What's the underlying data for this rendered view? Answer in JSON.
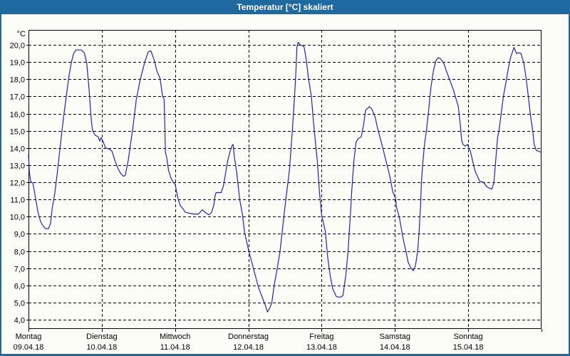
{
  "window": {
    "title": "Temperatur [°C] skaliert"
  },
  "colors": {
    "titlebar_bg": "#1E69A0",
    "titlebar_text": "#FFFFFF",
    "frame_border": "#1E69A0",
    "content_bg": "#FDFDF8",
    "grid": "#000000",
    "axis": "#000000",
    "text": "#000000",
    "series_line": "#2222C0"
  },
  "chart_data": {
    "type": "line",
    "title": "Temperatur [°C] skaliert",
    "y_unit_label": "°C",
    "xlabel": "",
    "ylabel": "Temperatur",
    "grid": "dashed",
    "legend": "none",
    "ylim": [
      3.45,
      20.9
    ],
    "y_ticks": [
      {
        "v": 20,
        "label": "20,0"
      },
      {
        "v": 19,
        "label": "19,0"
      },
      {
        "v": 18,
        "label": "18,0"
      },
      {
        "v": 17,
        "label": "17,0"
      },
      {
        "v": 16,
        "label": "16,0"
      },
      {
        "v": 15,
        "label": "15,0"
      },
      {
        "v": 14,
        "label": "14,0"
      },
      {
        "v": 13,
        "label": "13,0"
      },
      {
        "v": 12,
        "label": "12,0"
      },
      {
        "v": 11,
        "label": "11,0"
      },
      {
        "v": 10,
        "label": "10,0"
      },
      {
        "v": 9,
        "label": "9,0"
      },
      {
        "v": 8,
        "label": "8,0"
      },
      {
        "v": 7,
        "label": "7,0"
      },
      {
        "v": 6,
        "label": "6,0"
      },
      {
        "v": 5,
        "label": "5,0"
      },
      {
        "v": 4,
        "label": "4,0"
      }
    ],
    "x_categories": [
      {
        "day": "Montag",
        "date": "09.04.18"
      },
      {
        "day": "Dienstag",
        "date": "10.04.18"
      },
      {
        "day": "Mittwoch",
        "date": "11.04.18"
      },
      {
        "day": "Donnerstag",
        "date": "12.04.18"
      },
      {
        "day": "Freitag",
        "date": "13.04.18"
      },
      {
        "day": "Samstag",
        "date": "14.04.18"
      },
      {
        "day": "Sonntag",
        "date": "15.04.18"
      }
    ],
    "x_days_total": 7,
    "series": [
      {
        "name": "Temperatur [°C] skaliert",
        "points": [
          [
            0.0,
            13.6
          ],
          [
            0.012,
            12.6
          ],
          [
            0.03,
            12.05
          ],
          [
            0.06,
            11.95
          ],
          [
            0.095,
            11.1
          ],
          [
            0.127,
            10.3
          ],
          [
            0.165,
            9.7
          ],
          [
            0.2,
            9.45
          ],
          [
            0.233,
            9.3
          ],
          [
            0.272,
            9.3
          ],
          [
            0.3,
            9.6
          ],
          [
            0.324,
            10.5
          ],
          [
            0.357,
            11.3
          ],
          [
            0.389,
            12.4
          ],
          [
            0.421,
            13.65
          ],
          [
            0.454,
            14.9
          ],
          [
            0.486,
            16.05
          ],
          [
            0.518,
            17.1
          ],
          [
            0.551,
            18.15
          ],
          [
            0.583,
            18.95
          ],
          [
            0.615,
            19.5
          ],
          [
            0.648,
            19.7
          ],
          [
            0.72,
            19.7
          ],
          [
            0.761,
            19.55
          ],
          [
            0.794,
            18.95
          ],
          [
            0.81,
            18.2
          ],
          [
            0.826,
            17.4
          ],
          [
            0.843,
            16.4
          ],
          [
            0.859,
            15.5
          ],
          [
            0.875,
            15.0
          ],
          [
            0.908,
            14.75
          ],
          [
            0.95,
            14.65
          ],
          [
            0.972,
            14.4
          ],
          [
            0.99,
            14.6
          ],
          [
            1.02,
            14.35
          ],
          [
            1.05,
            14.0
          ],
          [
            1.1,
            13.95
          ],
          [
            1.14,
            13.8
          ],
          [
            1.18,
            13.25
          ],
          [
            1.22,
            12.8
          ],
          [
            1.26,
            12.5
          ],
          [
            1.295,
            12.35
          ],
          [
            1.32,
            12.4
          ],
          [
            1.36,
            13.25
          ],
          [
            1.425,
            15.2
          ],
          [
            1.47,
            16.8
          ],
          [
            1.525,
            18.0
          ],
          [
            1.59,
            19.05
          ],
          [
            1.635,
            19.6
          ],
          [
            1.67,
            19.65
          ],
          [
            1.72,
            19.05
          ],
          [
            1.75,
            18.5
          ],
          [
            1.795,
            18.05
          ],
          [
            1.83,
            17.0
          ],
          [
            1.85,
            16.85
          ],
          [
            1.862,
            15.0
          ],
          [
            1.868,
            13.75
          ],
          [
            1.885,
            13.45
          ],
          [
            1.91,
            12.7
          ],
          [
            1.94,
            12.3
          ],
          [
            1.975,
            12.0
          ],
          [
            2.0,
            11.9
          ],
          [
            2.04,
            11.05
          ],
          [
            2.07,
            10.65
          ],
          [
            2.11,
            10.45
          ],
          [
            2.14,
            10.25
          ],
          [
            2.19,
            10.2
          ],
          [
            2.26,
            10.15
          ],
          [
            2.32,
            10.15
          ],
          [
            2.37,
            10.4
          ],
          [
            2.41,
            10.25
          ],
          [
            2.46,
            10.1
          ],
          [
            2.5,
            10.25
          ],
          [
            2.53,
            10.7
          ],
          [
            2.545,
            11.2
          ],
          [
            2.56,
            11.4
          ],
          [
            2.63,
            11.4
          ],
          [
            2.66,
            11.8
          ],
          [
            2.69,
            12.55
          ],
          [
            2.72,
            13.3
          ],
          [
            2.75,
            13.8
          ],
          [
            2.78,
            14.15
          ],
          [
            2.792,
            14.2
          ],
          [
            2.81,
            13.45
          ],
          [
            2.84,
            12.6
          ],
          [
            2.856,
            12.0
          ],
          [
            2.88,
            11.05
          ],
          [
            2.92,
            10.1
          ],
          [
            2.95,
            9.05
          ],
          [
            3.0,
            8.1
          ],
          [
            3.08,
            6.8
          ],
          [
            3.14,
            5.85
          ],
          [
            3.19,
            5.3
          ],
          [
            3.235,
            4.8
          ],
          [
            3.26,
            4.45
          ],
          [
            3.29,
            4.65
          ],
          [
            3.32,
            5.0
          ],
          [
            3.35,
            5.95
          ],
          [
            3.39,
            6.9
          ],
          [
            3.43,
            7.9
          ],
          [
            3.5,
            10.6
          ],
          [
            3.56,
            12.7
          ],
          [
            3.6,
            15.0
          ],
          [
            3.63,
            17.0
          ],
          [
            3.65,
            18.5
          ],
          [
            3.662,
            19.9
          ],
          [
            3.68,
            20.15
          ],
          [
            3.71,
            20.0
          ],
          [
            3.76,
            19.9
          ],
          [
            3.79,
            19.15
          ],
          [
            3.82,
            18.05
          ],
          [
            3.86,
            17.0
          ],
          [
            3.888,
            15.55
          ],
          [
            3.9,
            15.0
          ],
          [
            3.94,
            13.25
          ],
          [
            3.97,
            11.45
          ],
          [
            4.0,
            10.1
          ],
          [
            4.05,
            9.15
          ],
          [
            4.08,
            7.7
          ],
          [
            4.115,
            6.6
          ],
          [
            4.15,
            5.8
          ],
          [
            4.2,
            5.35
          ],
          [
            4.25,
            5.3
          ],
          [
            4.29,
            5.4
          ],
          [
            4.33,
            6.6
          ],
          [
            4.36,
            8.0
          ],
          [
            4.39,
            9.95
          ],
          [
            4.41,
            11.45
          ],
          [
            4.44,
            13.25
          ],
          [
            4.47,
            14.35
          ],
          [
            4.5,
            14.55
          ],
          [
            4.54,
            14.65
          ],
          [
            4.57,
            15.3
          ],
          [
            4.6,
            16.2
          ],
          [
            4.65,
            16.4
          ],
          [
            4.68,
            16.3
          ],
          [
            4.73,
            15.8
          ],
          [
            4.76,
            15.2
          ],
          [
            4.81,
            14.4
          ],
          [
            4.86,
            13.55
          ],
          [
            4.91,
            12.7
          ],
          [
            4.94,
            12.15
          ],
          [
            4.97,
            11.45
          ],
          [
            5.01,
            11.05
          ],
          [
            5.022,
            10.55
          ],
          [
            5.06,
            9.95
          ],
          [
            5.09,
            9.25
          ],
          [
            5.12,
            8.55
          ],
          [
            5.15,
            8.0
          ],
          [
            5.18,
            7.35
          ],
          [
            5.22,
            7.0
          ],
          [
            5.25,
            6.85
          ],
          [
            5.28,
            7.15
          ],
          [
            5.31,
            8.0
          ],
          [
            5.33,
            9.1
          ],
          [
            5.35,
            10.7
          ],
          [
            5.362,
            12.05
          ],
          [
            5.38,
            13.15
          ],
          [
            5.405,
            14.25
          ],
          [
            5.43,
            15.0
          ],
          [
            5.46,
            16.2
          ],
          [
            5.49,
            17.5
          ],
          [
            5.525,
            18.5
          ],
          [
            5.56,
            19.1
          ],
          [
            5.59,
            19.25
          ],
          [
            5.62,
            19.2
          ],
          [
            5.67,
            18.9
          ],
          [
            5.7,
            18.5
          ],
          [
            5.74,
            18.05
          ],
          [
            5.77,
            17.7
          ],
          [
            5.8,
            17.35
          ],
          [
            5.83,
            16.9
          ],
          [
            5.865,
            16.4
          ],
          [
            5.89,
            15.45
          ],
          [
            5.91,
            14.45
          ],
          [
            5.93,
            14.2
          ],
          [
            5.96,
            14.1
          ],
          [
            5.99,
            14.2
          ],
          [
            6.03,
            13.8
          ],
          [
            6.06,
            13.25
          ],
          [
            6.09,
            12.7
          ],
          [
            6.13,
            12.3
          ],
          [
            6.16,
            12.05
          ],
          [
            6.21,
            12.0
          ],
          [
            6.25,
            11.75
          ],
          [
            6.29,
            11.65
          ],
          [
            6.32,
            11.6
          ],
          [
            6.35,
            11.95
          ],
          [
            6.37,
            13.0
          ],
          [
            6.4,
            14.6
          ],
          [
            6.42,
            15.0
          ],
          [
            6.45,
            16.0
          ],
          [
            6.48,
            17.0
          ],
          [
            6.51,
            17.7
          ],
          [
            6.55,
            18.7
          ],
          [
            6.58,
            19.3
          ],
          [
            6.625,
            19.85
          ],
          [
            6.66,
            19.5
          ],
          [
            6.69,
            19.55
          ],
          [
            6.72,
            19.5
          ],
          [
            6.76,
            18.9
          ],
          [
            6.79,
            18.05
          ],
          [
            6.82,
            17.0
          ],
          [
            6.85,
            15.85
          ],
          [
            6.88,
            15.0
          ],
          [
            6.9,
            14.2
          ],
          [
            6.93,
            13.85
          ],
          [
            6.97,
            13.8
          ],
          [
            6.99,
            13.75
          ]
        ]
      }
    ]
  }
}
